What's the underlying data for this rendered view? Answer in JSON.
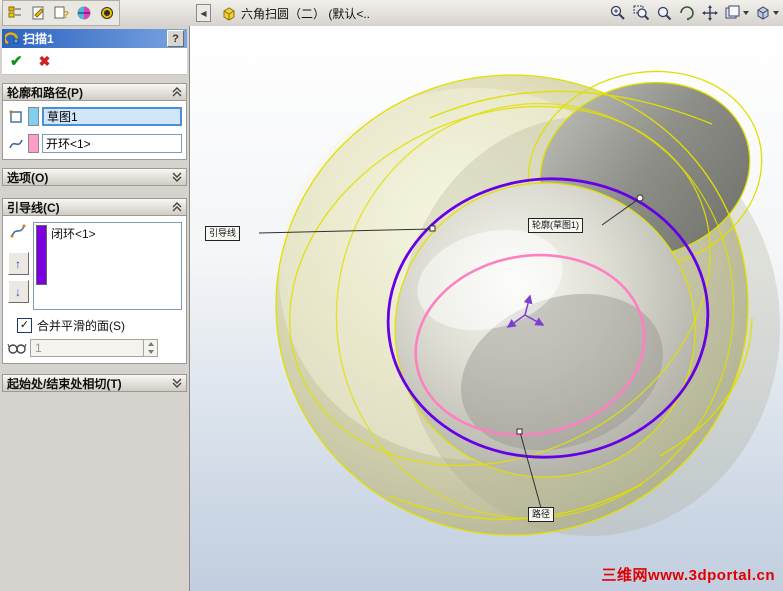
{
  "topbar": {
    "doc_title": "六角扫圆（二） (默认<..",
    "left_tabs": [
      "featuremanager-tab",
      "propertymanager-tab",
      "configurationmanager-tab",
      "dimxpertmanager-tab",
      "displaymanager-tab"
    ],
    "view_tools": [
      "zoom-in-out",
      "zoom-area",
      "zoom-to-fit",
      "rotate-view",
      "pan",
      "view-orientation",
      "display-style"
    ]
  },
  "icons": {
    "ok": "✔",
    "cancel": "✖",
    "help": "?",
    "move-up": "↑",
    "move-down": "↓",
    "collapse-left": "◀",
    "check": "✓"
  },
  "panel": {
    "title": "扫描1",
    "groups": {
      "profile_path": {
        "label": "轮廓和路径(P)",
        "collapsed": false
      },
      "options": {
        "label": "选项(O)",
        "collapsed": true
      },
      "guide_curves": {
        "label": "引导线(C)",
        "collapsed": false
      },
      "tangency": {
        "label": "起始处/结束处相切(T)",
        "collapsed": true
      }
    },
    "profile": {
      "value": "草图1",
      "swatch_color": "#7fd0f0"
    },
    "path": {
      "value": "开环<1>",
      "swatch_color": "#ff9ec8"
    },
    "guide": {
      "value": "闭环<1>",
      "swatch_color": "#7a00e0",
      "merge_label": "合并平滑的面(S)",
      "merge_checked": true,
      "sections_value": "1"
    }
  },
  "viewport": {
    "callouts": {
      "guide": "引导线",
      "profile": "轮廓(草图1)",
      "path": "路径"
    },
    "watermark": "三维网www.3dportal.cn",
    "colors": {
      "guide_curve": "#6600e6",
      "path_curve": "#ff80c0",
      "edge": "#e0e000"
    }
  }
}
